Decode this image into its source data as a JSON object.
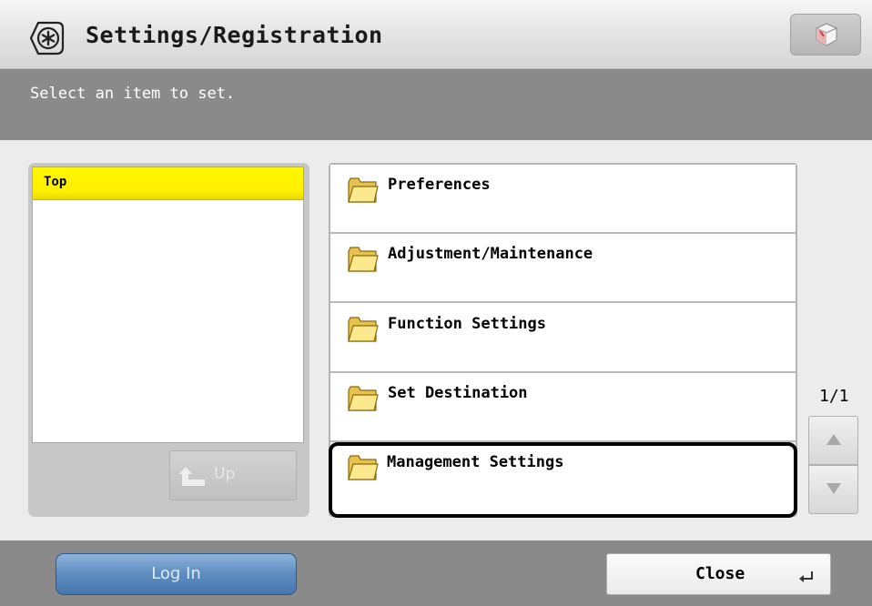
{
  "header": {
    "title": "Settings/Registration",
    "icon": "settings-star-icon",
    "corner_icon": "cube-status-icon"
  },
  "instruction": {
    "text": "Select an item to set."
  },
  "tree": {
    "items": [
      {
        "label": "Top",
        "highlight_color": "#fff200"
      }
    ],
    "up_button_label": "Up"
  },
  "menu": {
    "items": [
      {
        "label": "Preferences",
        "icon": "folder-icon"
      },
      {
        "label": "Adjustment/Maintenance",
        "icon": "folder-icon"
      },
      {
        "label": "Function Settings",
        "icon": "folder-icon"
      },
      {
        "label": "Set Destination",
        "icon": "folder-icon"
      },
      {
        "label": "Management Settings",
        "icon": "folder-icon",
        "selected": true
      }
    ]
  },
  "pagination": {
    "text": "1/1"
  },
  "footer": {
    "login_label": "Log In",
    "close_label": "Close"
  },
  "colors": {
    "band_gray": "#8a8a8a",
    "login_blue": "#5d8cc0",
    "selection_border": "#000000"
  }
}
